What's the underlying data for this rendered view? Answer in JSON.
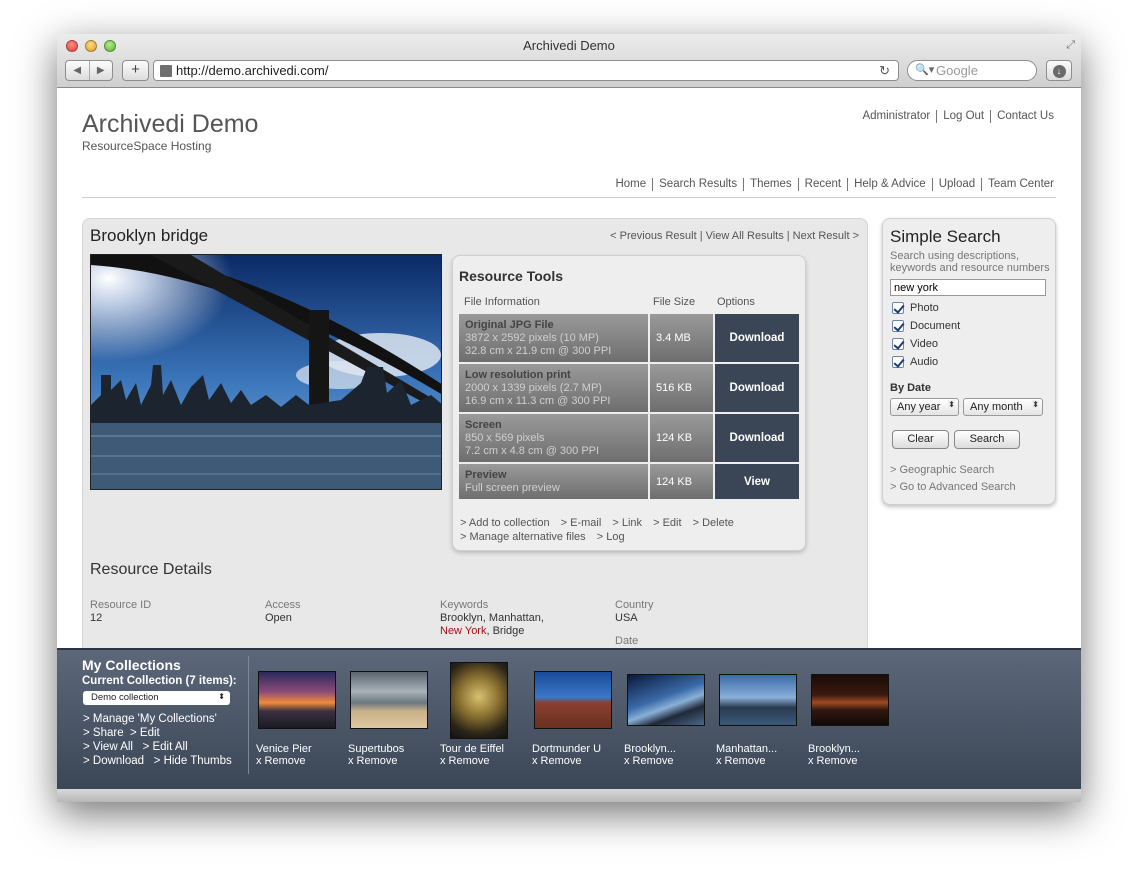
{
  "browser": {
    "window_title": "Archivedi Demo",
    "url": "http://demo.archivedi.com/",
    "search_placeholder": "Google"
  },
  "header": {
    "site_title": "Archivedi Demo",
    "subtitle": "ResourceSpace Hosting",
    "top_links": [
      "Administrator",
      "Log Out",
      "Contact Us"
    ],
    "nav": [
      "Home",
      "Search Results",
      "Themes",
      "Recent",
      "Help & Advice",
      "Upload",
      "Team Center"
    ]
  },
  "resource": {
    "title": "Brooklyn bridge",
    "nav": "< Previous Result | View All Results | Next Result >"
  },
  "tools": {
    "title": "Resource Tools",
    "headers": {
      "info": "File Information",
      "size": "File Size",
      "options": "Options"
    },
    "files": [
      {
        "name": "Original JPG File",
        "line1": "3872 x 2592 pixels (10 MP)",
        "line2": "32.8 cm x 21.9 cm @ 300 PPI",
        "size": "3.4 MB",
        "action": "Download"
      },
      {
        "name": "Low resolution print",
        "line1": "2000 x 1339 pixels (2.7 MP)",
        "line2": "16.9 cm x 11.3 cm @ 300 PPI",
        "size": "516 KB",
        "action": "Download"
      },
      {
        "name": "Screen",
        "line1": "850 x 569 pixels",
        "line2": "7.2 cm x 4.8 cm @ 300 PPI",
        "size": "124 KB",
        "action": "Download"
      },
      {
        "name": "Preview",
        "line1": "Full screen preview",
        "line2": "",
        "size": "124 KB",
        "action": "View"
      }
    ],
    "links_row1": [
      "> Add to collection",
      "> E-mail",
      "> Link",
      "> Edit",
      "> Delete"
    ],
    "links_row2": [
      "> Manage alternative files",
      "> Log"
    ]
  },
  "details": {
    "title": "Resource Details",
    "resource_id_label": "Resource ID",
    "resource_id": "12",
    "access_label": "Access",
    "access": "Open",
    "keywords_label": "Keywords",
    "keywords_pre": "Brooklyn, Manhattan,",
    "keywords_highlight": "New York",
    "keywords_post": ", Bridge",
    "country_label": "Country",
    "country": "USA",
    "date_label": "Date"
  },
  "search": {
    "title": "Simple Search",
    "description": "Search using descriptions, keywords and resource numbers",
    "query": "new york",
    "types": [
      "Photo",
      "Document",
      "Video",
      "Audio"
    ],
    "by_date_label": "By Date",
    "year_select": "Any year",
    "month_select": "Any month",
    "clear_label": "Clear",
    "search_label": "Search",
    "geo_link": "> Geographic Search",
    "advanced_link": "> Go to Advanced Search"
  },
  "collections": {
    "title": "My Collections",
    "current": "Current Collection (7 items):",
    "selected": "Demo collection",
    "links": {
      "manage": "> Manage 'My Collections'",
      "share": "> Share",
      "edit": "> Edit",
      "view_all": "> View All",
      "edit_all": "> Edit All",
      "download": "> Download",
      "hide_thumbs": "> Hide Thumbs"
    },
    "remove_label": "x Remove",
    "items": [
      "Venice Pier",
      "Supertubos",
      "Tour de Eiffel",
      "Dortmunder U",
      "Brooklyn...",
      "Manhattan...",
      "Brooklyn..."
    ]
  },
  "colors": {
    "download_button": "#3a4656",
    "collection_bar": "#4a5567",
    "keyword_highlight": "#a0101a"
  }
}
